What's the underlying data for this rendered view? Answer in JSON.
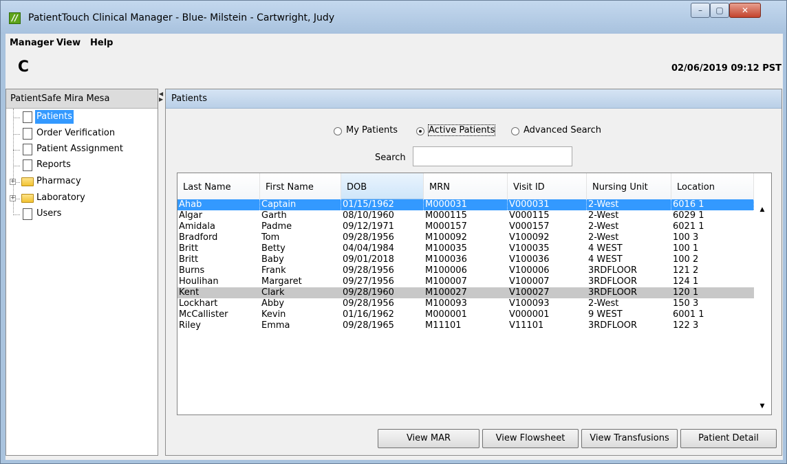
{
  "window": {
    "title": "PatientTouch Clinical Manager - Blue- Milstein - Cartwright, Judy",
    "app_icon": "//",
    "controls": {
      "minimize": "–",
      "maximize": "▢",
      "close": "✕"
    }
  },
  "menu": {
    "items": [
      {
        "label": "Manager"
      },
      {
        "label": "View"
      },
      {
        "label": "Help"
      }
    ]
  },
  "toolbar": {
    "refresh_icon": "refresh-icon",
    "refresh_glyph": "C",
    "datetime": "02/06/2019 09:12 PST"
  },
  "tree": {
    "header": "PatientSafe Mira Mesa",
    "items": [
      {
        "label": "Patients",
        "icon": "document-icon",
        "selected": true
      },
      {
        "label": "Order Verification",
        "icon": "document-icon"
      },
      {
        "label": "Patient Assignment",
        "icon": "document-icon"
      },
      {
        "label": "Reports",
        "icon": "document-icon"
      },
      {
        "label": "Pharmacy",
        "icon": "folder-icon",
        "expandable": true
      },
      {
        "label": "Laboratory",
        "icon": "folder-icon",
        "expandable": true
      },
      {
        "label": "Users",
        "icon": "document-icon"
      }
    ],
    "expander_glyph": "+"
  },
  "patients": {
    "header": "Patients",
    "filters": [
      {
        "label": "My Patients",
        "checked": false
      },
      {
        "label": "Active Patients",
        "checked": true
      },
      {
        "label": "Advanced Search",
        "checked": false
      }
    ],
    "search_label": "Search",
    "search_value": "",
    "columns": [
      "Last Name",
      "First Name",
      "DOB",
      "MRN",
      "Visit ID",
      "Nursing Unit",
      "Location"
    ],
    "sorted_column": "DOB",
    "rows": [
      [
        "Ahab",
        "Captain",
        "01/15/1962",
        "M000031",
        "V000031",
        "2-West",
        "6016 1"
      ],
      [
        "Algar",
        "Garth",
        "08/10/1960",
        "M000115",
        "V000115",
        "2-West",
        "6029 1"
      ],
      [
        "Amidala",
        "Padme",
        "09/12/1971",
        "M000157",
        "V000157",
        "2-West",
        "6021 1"
      ],
      [
        "Bradford",
        "Tom",
        "09/28/1956",
        "M100092",
        "V100092",
        "2-West",
        "100 3"
      ],
      [
        "Britt",
        "Betty",
        "04/04/1984",
        "M100035",
        "V100035",
        "4 WEST",
        "100 1"
      ],
      [
        "Britt",
        "Baby",
        "09/01/2018",
        "M100036",
        "V100036",
        "4 WEST",
        "100 2"
      ],
      [
        "Burns",
        "Frank",
        "09/28/1956",
        "M100006",
        "V100006",
        "3RDFLOOR",
        "121 2"
      ],
      [
        "Houlihan",
        "Margaret",
        "09/27/1956",
        "M100007",
        "V100007",
        "3RDFLOOR",
        "124 1"
      ],
      [
        "Kent",
        "Clark",
        "09/28/1960",
        "M100027",
        "V100027",
        "3RDFLOOR",
        "120 1"
      ],
      [
        "Lockhart",
        "Abby",
        "09/28/1956",
        "M100093",
        "V100093",
        "2-West",
        "150 3"
      ],
      [
        "McCallister",
        "Kevin",
        "01/16/1962",
        "M000001",
        "V000001",
        "9 WEST",
        "6001 1"
      ],
      [
        "Riley",
        "Emma",
        "09/28/1965",
        "M11101",
        "V11101",
        "3RDFLOOR",
        "122 3"
      ]
    ],
    "selected_row": "Ahab",
    "highlighted_row": "Kent",
    "scroll_up_glyph": "▲",
    "scroll_down_glyph": "▼",
    "buttons": [
      {
        "label": "View MAR"
      },
      {
        "label": "View Flowsheet"
      },
      {
        "label": "View Transfusions"
      },
      {
        "label": "Patient Detail"
      }
    ]
  },
  "colors": {
    "selection": "#3399ff",
    "highlight_row": "#c8c8c8",
    "title_bar": "#a8c2de"
  }
}
